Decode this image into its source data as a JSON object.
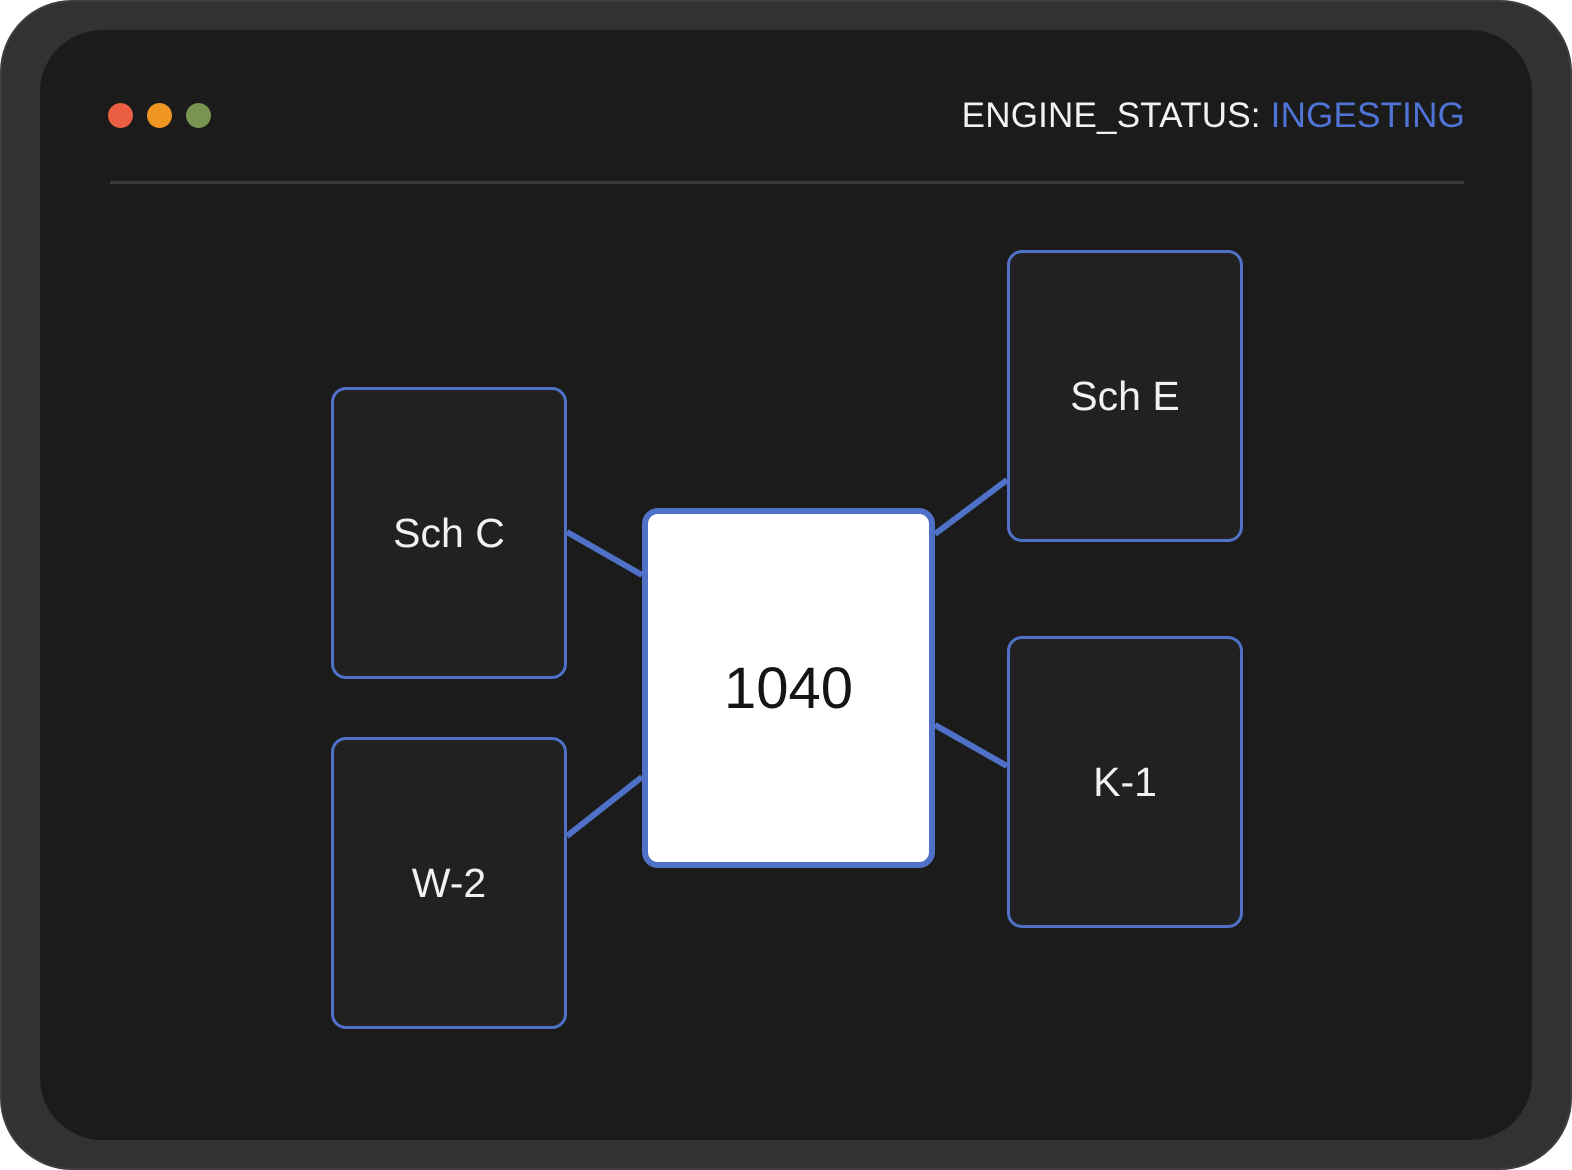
{
  "window": {
    "traffic_lights": [
      "#ea5f43",
      "#ee9621",
      "#779451"
    ]
  },
  "header": {
    "status_label": "ENGINE_STATUS:",
    "status_value": "INGESTING",
    "status_value_color": "#4f74d6"
  },
  "diagram": {
    "center_node": "1040",
    "input_nodes": {
      "sch_c": "Sch C",
      "w2": "W-2",
      "sch_e": "Sch E",
      "k1": "K-1"
    },
    "edges": [
      [
        "Sch C",
        "1040"
      ],
      [
        "W-2",
        "1040"
      ],
      [
        "Sch E",
        "1040"
      ],
      [
        "K-1",
        "1040"
      ]
    ],
    "accent_color": "#4f72c8"
  }
}
